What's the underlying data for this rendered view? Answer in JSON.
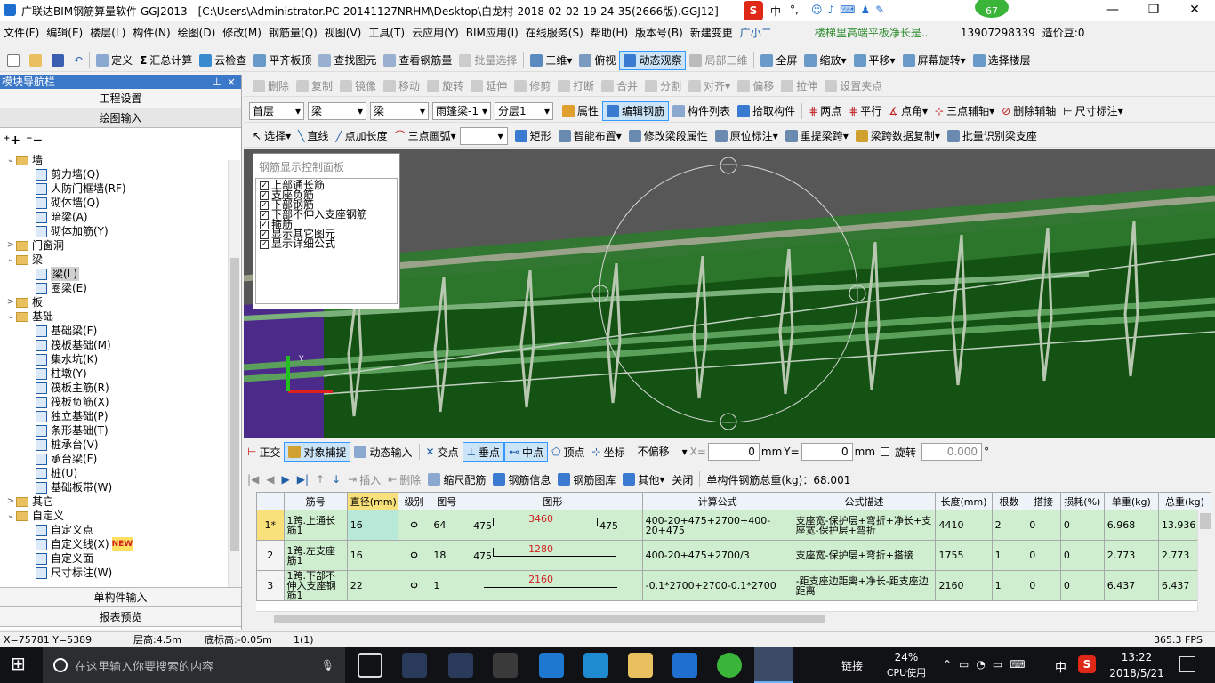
{
  "window": {
    "title": "广联达BIM钢筋算量软件 GGJ2013 - [C:\\Users\\Administrator.PC-20141127NRHM\\Desktop\\白龙村-2018-02-02-19-24-35(2666版).GGJ12]",
    "badge": "67",
    "ime": [
      "中",
      "°,"
    ],
    "controls": [
      "—",
      "❐",
      "✕"
    ]
  },
  "menu": [
    "文件(F)",
    "编辑(E)",
    "楼层(L)",
    "构件(N)",
    "绘图(D)",
    "修改(M)",
    "钢筋量(Q)",
    "视图(V)",
    "工具(T)",
    "云应用(Y)",
    "BIM应用(I)",
    "在线服务(S)",
    "帮助(H)",
    "版本号(B)",
    "新建变更",
    "广小二",
    "楼梯里高端平板净长是...",
    "13907298339",
    "造价豆:0"
  ],
  "toolbar1": [
    "定义",
    "汇总计算",
    "云检查",
    "平齐板顶",
    "查找图元",
    "查看钢筋量",
    "批量选择",
    "三维",
    "俯视",
    "动态观察",
    "局部三维",
    "全屏",
    "缩放",
    "平移",
    "屏幕旋转",
    "选择楼层"
  ],
  "toolbar2": [
    "删除",
    "复制",
    "镜像",
    "移动",
    "旋转",
    "延伸",
    "修剪",
    "打断",
    "合并",
    "分割",
    "对齐",
    "偏移",
    "拉伸",
    "设置夹点"
  ],
  "toolbar3": {
    "floor": "首层",
    "type1": "梁",
    "type2": "梁",
    "member": "雨篷梁-1",
    "layer": "分层1",
    "items": [
      "属性",
      "编辑钢筋",
      "构件列表",
      "拾取构件",
      "两点",
      "平行",
      "点角",
      "三点辅轴",
      "删除辅轴",
      "尺寸标注"
    ]
  },
  "toolbar4": [
    "选择",
    "直线",
    "点加长度",
    "三点画弧",
    "矩形",
    "智能布置",
    "修改梁段属性",
    "原位标注",
    "重提梁跨",
    "梁跨数据复制",
    "批量识别梁支座"
  ],
  "leftpanel": {
    "title": "模块导航栏",
    "pin": "ᵖ",
    "close": "×",
    "btn_project": "工程设置",
    "btn_draw": "绘图输入",
    "btn_single": "单构件输入",
    "btn_report": "报表预览",
    "tree": [
      {
        "t": "墙",
        "lvl": 0,
        "type": "folder",
        "exp": "⌄"
      },
      {
        "t": "剪力墙(Q)",
        "lvl": 1,
        "type": "leaf"
      },
      {
        "t": "人防门框墙(RF)",
        "lvl": 1,
        "type": "leaf"
      },
      {
        "t": "砌体墙(Q)",
        "lvl": 1,
        "type": "leaf"
      },
      {
        "t": "暗梁(A)",
        "lvl": 1,
        "type": "leaf"
      },
      {
        "t": "砌体加筋(Y)",
        "lvl": 1,
        "type": "leaf"
      },
      {
        "t": "门窗洞",
        "lvl": 0,
        "type": "folder",
        "exp": ">"
      },
      {
        "t": "梁",
        "lvl": 0,
        "type": "folder",
        "exp": "⌄"
      },
      {
        "t": "梁(L)",
        "lvl": 1,
        "type": "leaf",
        "sel": true
      },
      {
        "t": "圈梁(E)",
        "lvl": 1,
        "type": "leaf"
      },
      {
        "t": "板",
        "lvl": 0,
        "type": "folder",
        "exp": ">"
      },
      {
        "t": "基础",
        "lvl": 0,
        "type": "folder",
        "exp": "⌄"
      },
      {
        "t": "基础梁(F)",
        "lvl": 1,
        "type": "leaf"
      },
      {
        "t": "筏板基础(M)",
        "lvl": 1,
        "type": "leaf"
      },
      {
        "t": "集水坑(K)",
        "lvl": 1,
        "type": "leaf"
      },
      {
        "t": "柱墩(Y)",
        "lvl": 1,
        "type": "leaf"
      },
      {
        "t": "筏板主筋(R)",
        "lvl": 1,
        "type": "leaf"
      },
      {
        "t": "筏板负筋(X)",
        "lvl": 1,
        "type": "leaf"
      },
      {
        "t": "独立基础(P)",
        "lvl": 1,
        "type": "leaf"
      },
      {
        "t": "条形基础(T)",
        "lvl": 1,
        "type": "leaf"
      },
      {
        "t": "桩承台(V)",
        "lvl": 1,
        "type": "leaf"
      },
      {
        "t": "承台梁(F)",
        "lvl": 1,
        "type": "leaf"
      },
      {
        "t": "桩(U)",
        "lvl": 1,
        "type": "leaf"
      },
      {
        "t": "基础板带(W)",
        "lvl": 1,
        "type": "leaf"
      },
      {
        "t": "其它",
        "lvl": 0,
        "type": "folder",
        "exp": ">"
      },
      {
        "t": "自定义",
        "lvl": 0,
        "type": "folder",
        "exp": "⌄"
      },
      {
        "t": "自定义点",
        "lvl": 1,
        "type": "leaf"
      },
      {
        "t": "自定义线(X)",
        "lvl": 1,
        "type": "leaf",
        "new": "NEW"
      },
      {
        "t": "自定义面",
        "lvl": 1,
        "type": "leaf"
      },
      {
        "t": "尺寸标注(W)",
        "lvl": 1,
        "type": "leaf"
      }
    ]
  },
  "controlpanel": {
    "title": "钢筋显示控制面板",
    "items": [
      "上部通长筋",
      "支座负筋",
      "下部钢筋",
      "下部不伸入支座钢筋",
      "箍筋",
      "显示其它图元",
      "显示详细公式"
    ]
  },
  "snapbar": {
    "items": [
      "正交",
      "对象捕捉",
      "动态输入",
      "交点",
      "垂点",
      "中点",
      "顶点",
      "坐标"
    ],
    "offset": "不偏移",
    "x_label": "X=",
    "x_val": "0",
    "y_label": "Y=",
    "y_val": "0",
    "unit": "mm",
    "rotate_label": "旋转",
    "rotate_val": "0.000",
    "deg": "°"
  },
  "rebarbar": {
    "items": [
      "插入",
      "删除",
      "缩尺配筋",
      "钢筋信息",
      "钢筋图库",
      "其他",
      "关闭"
    ],
    "total": "单构件钢筋总重(kg)：68.001"
  },
  "grid": {
    "headers": [
      "筋号",
      "直径(mm)",
      "级别",
      "图号",
      "图形",
      "计算公式",
      "公式描述",
      "长度(mm)",
      "根数",
      "搭接",
      "损耗(%)",
      "单重(kg)",
      "总重(kg)"
    ],
    "rows": [
      {
        "no": "1*",
        "name": "1跨.上通长筋1",
        "dia": "16",
        "grade": "Φ",
        "fig": "64",
        "shape_l": "475",
        "shape_m": "3460",
        "shape_r": "475",
        "formula": "400-20+475+2700+400-20+475",
        "desc": "支座宽-保护层+弯折+净长+支座宽-保护层+弯折",
        "len": "4410",
        "count": "2",
        "lap": "0",
        "loss": "0",
        "unit": "6.968",
        "total": "13.936"
      },
      {
        "no": "2",
        "name": "1跨.左支座筋1",
        "dia": "16",
        "grade": "Φ",
        "fig": "18",
        "shape_l": "475",
        "shape_m": "1280",
        "shape_r": "",
        "formula": "400-20+475+2700/3",
        "desc": "支座宽-保护层+弯折+搭接",
        "len": "1755",
        "count": "1",
        "lap": "0",
        "loss": "0",
        "unit": "2.773",
        "total": "2.773"
      },
      {
        "no": "3",
        "name": "1跨.下部不伸入支座钢筋1",
        "dia": "22",
        "grade": "Φ",
        "fig": "1",
        "shape_l": "",
        "shape_m": "2160",
        "shape_r": "",
        "formula": "-0.1*2700+2700-0.1*2700",
        "desc": "-距支座边距离+净长-距支座边距离",
        "len": "2160",
        "count": "1",
        "lap": "0",
        "loss": "0",
        "unit": "6.437",
        "total": "6.437"
      }
    ]
  },
  "status": {
    "coords": "X=75781 Y=5389",
    "floor_h": "层高:4.5m",
    "base_h": "底标高:-0.05m",
    "sel": "1(1)",
    "fps": "365.3 FPS"
  },
  "taskbar": {
    "search": "在这里输入你要搜索的内容",
    "link": "链接",
    "cpu": "24%",
    "cpu_label": "CPU使用",
    "time": "13:22",
    "date": "2018/5/21",
    "lang": "中",
    "start": "⊞"
  },
  "colors": {
    "titlebar_accent": "#3c78c8",
    "selected_row": "#cfedcf",
    "beam_green": "#1f6a1f",
    "axis_red": "#e02020"
  }
}
